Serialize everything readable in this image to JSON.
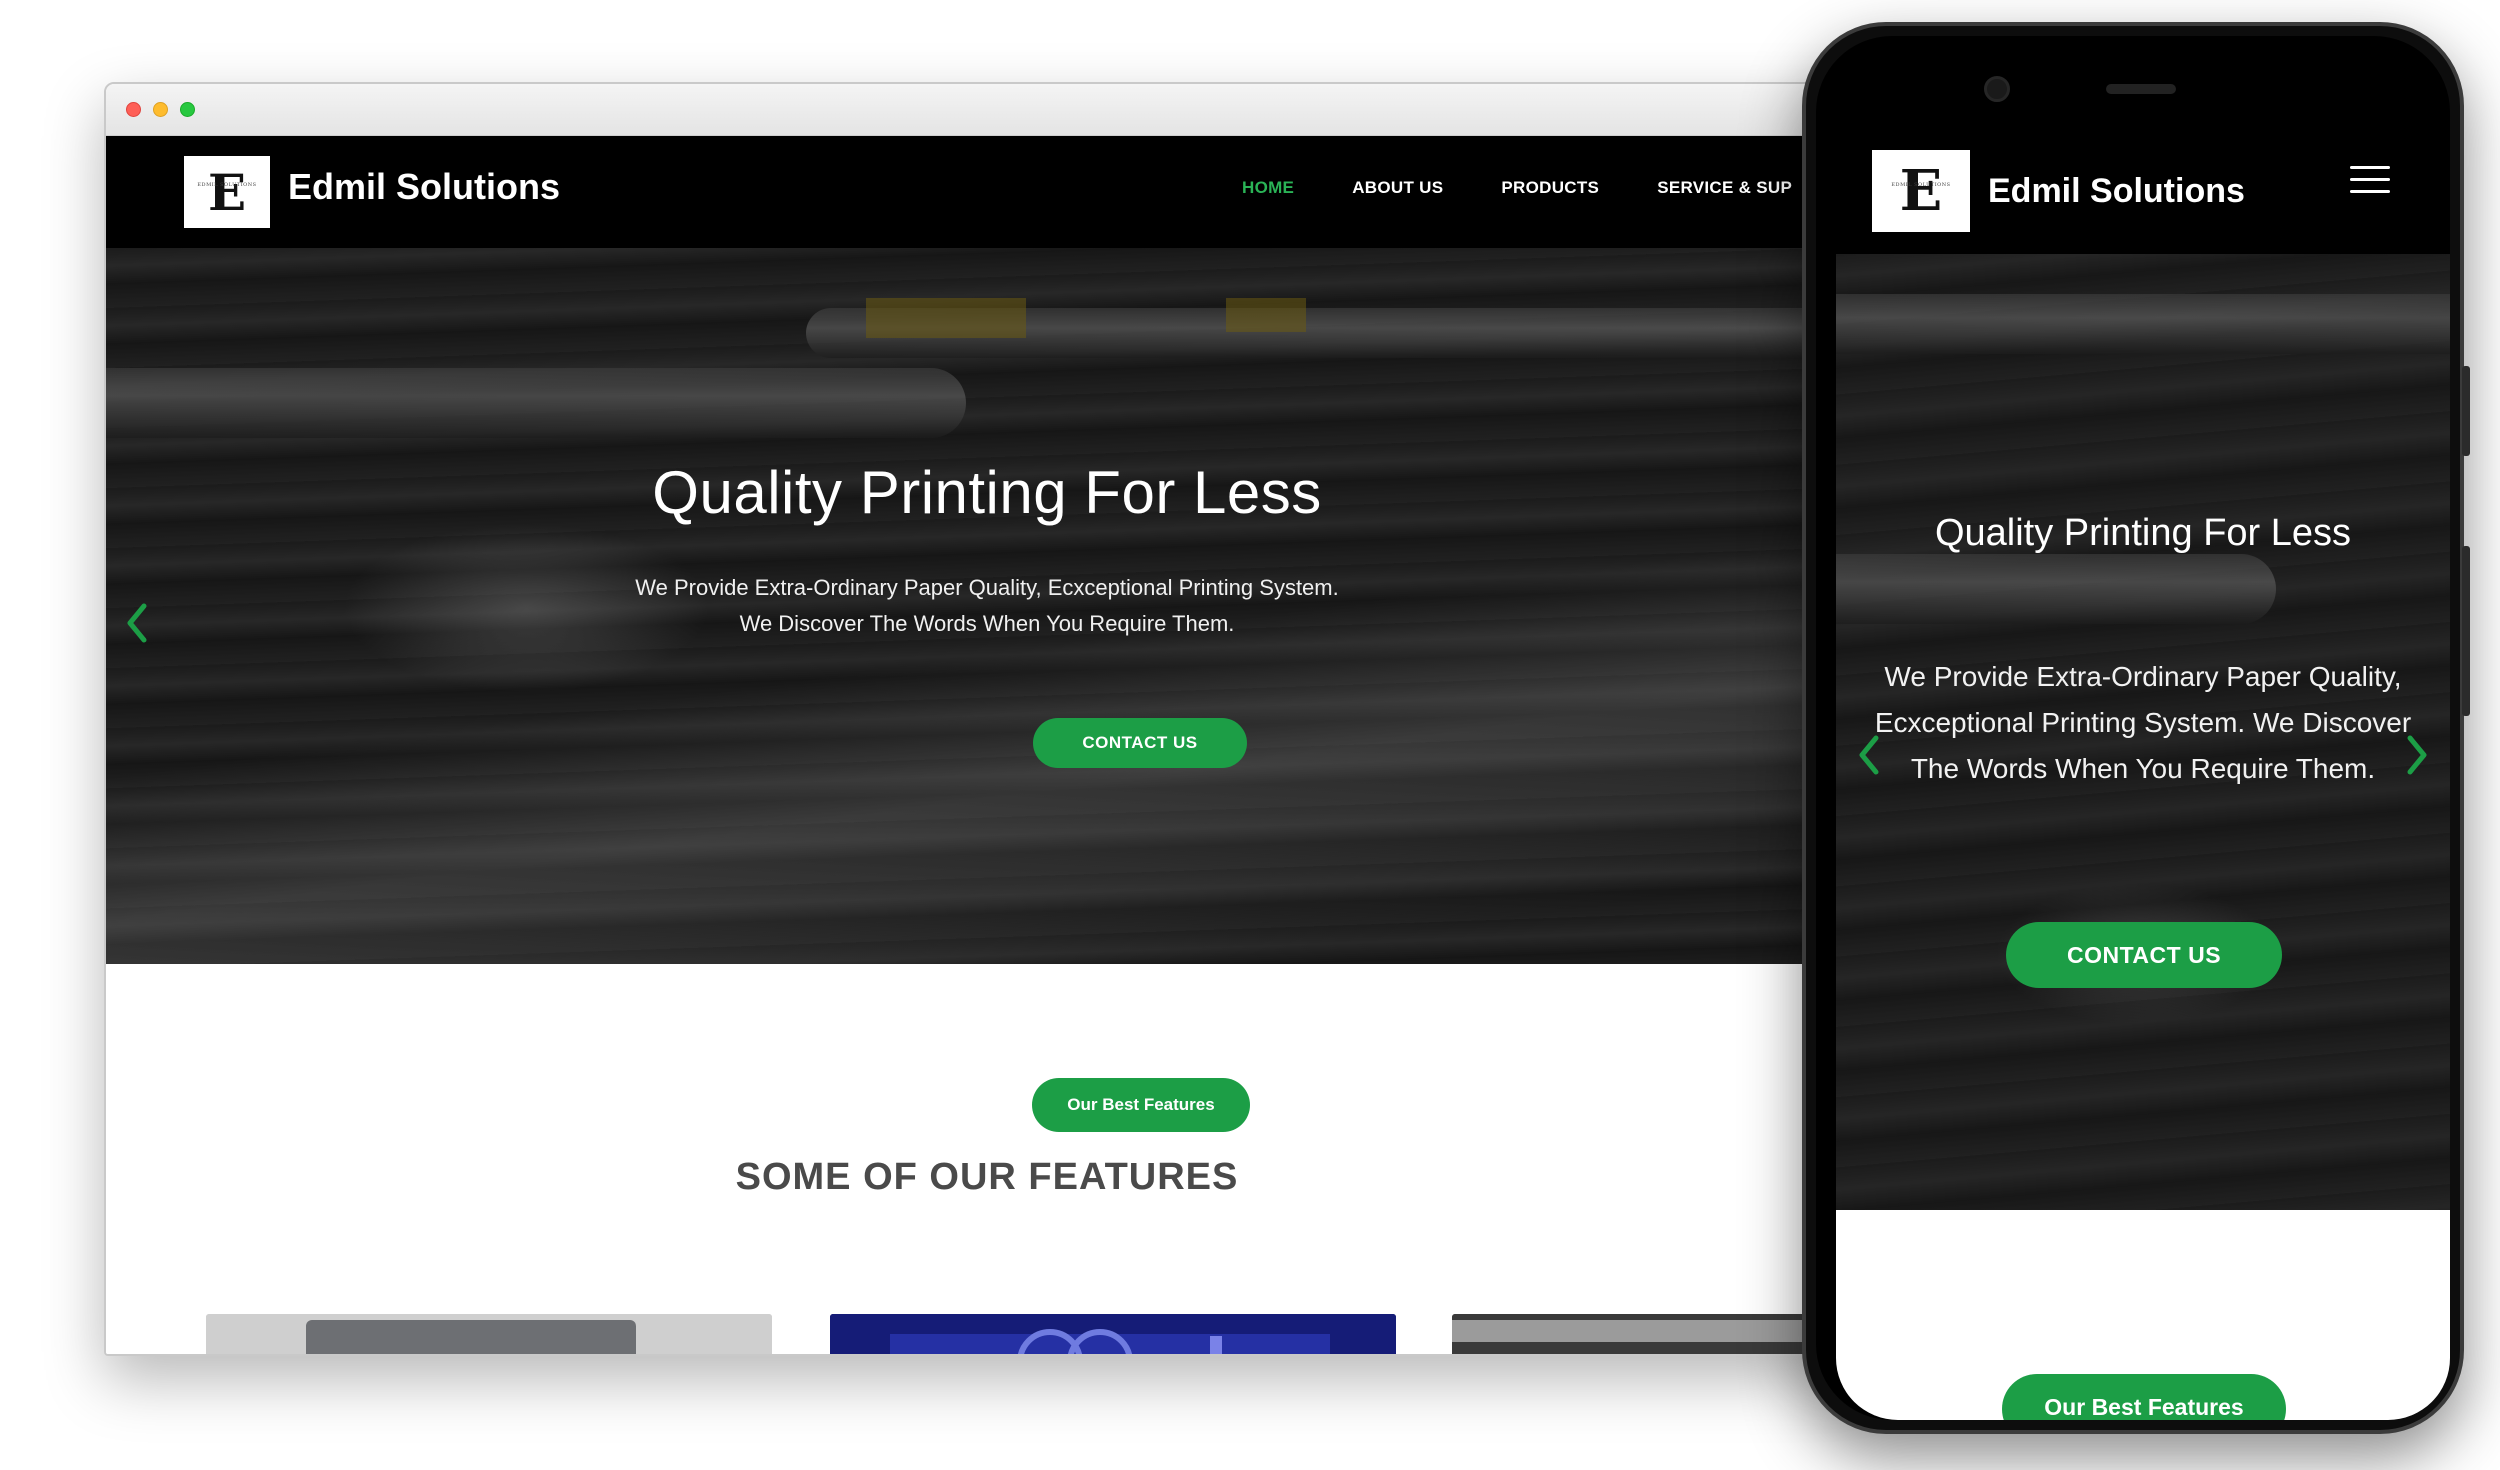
{
  "brand": {
    "name": "Edmil Solutions",
    "logo_letter": "E",
    "logo_small_text": "EDMIL SOLUTIONS"
  },
  "desktop": {
    "nav": {
      "items": [
        {
          "label": "HOME",
          "active": true
        },
        {
          "label": "ABOUT US",
          "active": false
        },
        {
          "label": "PRODUCTS",
          "active": false
        },
        {
          "label": "SERVICE & SUP",
          "active": false
        }
      ]
    },
    "hero": {
      "title": "Quality Printing For Less",
      "subtitle_line1": "We Provide Extra-Ordinary Paper Quality, Ecxceptional Printing System.",
      "subtitle_line2": "We Discover The Words When You Require Them.",
      "cta": "CONTACT US"
    },
    "features": {
      "badge": "Our Best Features",
      "title": "SOME OF OUR FEATURES"
    }
  },
  "mobile": {
    "hero": {
      "title": "Quality Printing For Less",
      "subtitle": "We Provide Extra-Ordinary Paper Quality, Ecxceptional Printing System. We Discover The Words When You Require Them.",
      "cta": "CONTACT US"
    },
    "features_badge": "Our Best Features"
  },
  "colors": {
    "accent_green": "#1c9e46",
    "active_nav_green": "#2ab356",
    "nav_background": "#000000"
  },
  "icons": [
    "chevron-left-icon",
    "chevron-right-icon",
    "hamburger-menu-icon"
  ]
}
